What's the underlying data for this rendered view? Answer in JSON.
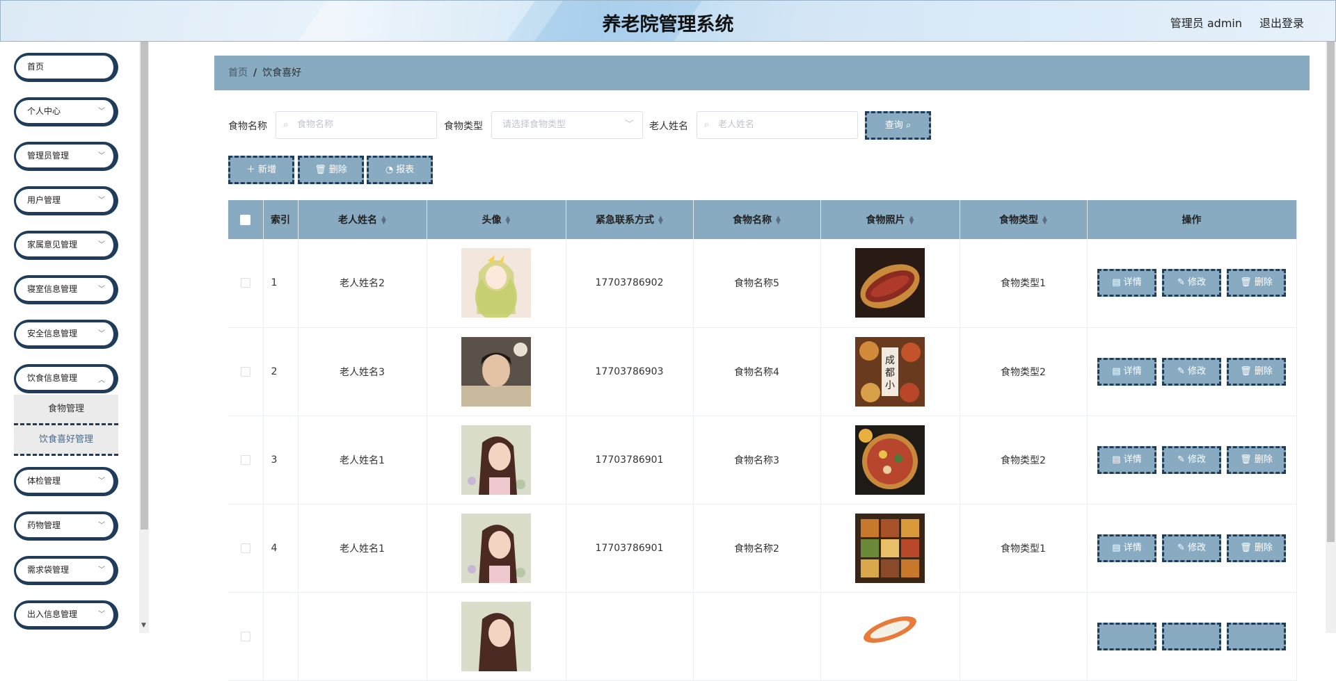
{
  "header": {
    "title": "养老院管理系统",
    "user": "管理员 admin",
    "logout": "退出登录"
  },
  "sidebar": {
    "items": [
      {
        "label": "首页",
        "has_chevron": false
      },
      {
        "label": "个人中心",
        "has_chevron": true
      },
      {
        "label": "管理员管理",
        "has_chevron": true
      },
      {
        "label": "用户管理",
        "has_chevron": true
      },
      {
        "label": "家属意见管理",
        "has_chevron": true
      },
      {
        "label": "寝室信息管理",
        "has_chevron": true
      },
      {
        "label": "安全信息管理",
        "has_chevron": true
      },
      {
        "label": "饮食信息管理",
        "has_chevron": true,
        "expanded": true
      },
      {
        "label": "体检管理",
        "has_chevron": true
      },
      {
        "label": "药物管理",
        "has_chevron": true
      },
      {
        "label": "需求袋管理",
        "has_chevron": true
      },
      {
        "label": "出入信息管理",
        "has_chevron": true
      }
    ],
    "submenu": [
      "食物管理",
      "饮食喜好管理"
    ]
  },
  "breadcrumb": {
    "home": "首页",
    "sep": "/",
    "current": "饮食喜好"
  },
  "search": {
    "food_name_label": "食物名称",
    "food_name_placeholder": "食物名称",
    "food_type_label": "食物类型",
    "food_type_placeholder": "请选择食物类型",
    "elder_name_label": "老人姓名",
    "elder_name_placeholder": "老人姓名",
    "query_button": "查询"
  },
  "toolbar": {
    "add": "新增",
    "delete": "删除",
    "report": "报表"
  },
  "table": {
    "headers": [
      "索引",
      "老人姓名",
      "头像",
      "紧急联系方式",
      "食物名称",
      "食物照片",
      "食物类型",
      "操作"
    ],
    "rows": [
      {
        "index": "1",
        "elder": "老人姓名2",
        "phone": "17703786902",
        "food": "食物名称5",
        "type": "食物类型1"
      },
      {
        "index": "2",
        "elder": "老人姓名3",
        "phone": "17703786903",
        "food": "食物名称4",
        "type": "食物类型2"
      },
      {
        "index": "3",
        "elder": "老人姓名1",
        "phone": "17703786901",
        "food": "食物名称3",
        "type": "食物类型2"
      },
      {
        "index": "4",
        "elder": "老人姓名1",
        "phone": "17703786901",
        "food": "食物名称2",
        "type": "食物类型1"
      }
    ],
    "row_actions": {
      "detail": "详情",
      "edit": "修改",
      "delete": "删除"
    }
  },
  "colors": {
    "accent": "#88abc1",
    "dark": "#1f3d5a"
  }
}
